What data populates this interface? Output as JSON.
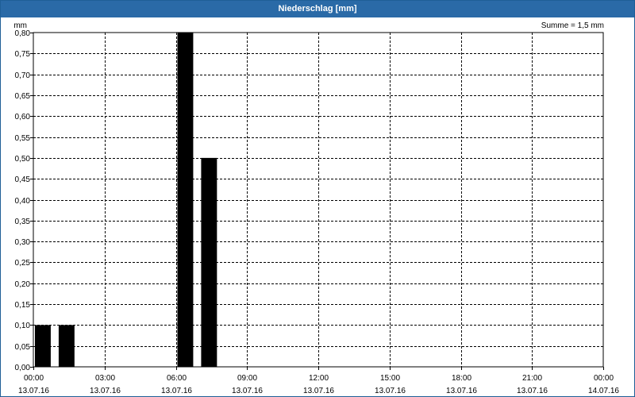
{
  "window": {
    "title": "Niederschlag [mm]"
  },
  "summary": "Summe = 1,5 mm",
  "chart_data": {
    "type": "bar",
    "title": "Niederschlag [mm]",
    "ylabel": "mm",
    "ylim": [
      0,
      0.8
    ],
    "y_ticks": [
      "0,00",
      "0,05",
      "0,10",
      "0,15",
      "0,20",
      "0,25",
      "0,30",
      "0,35",
      "0,40",
      "0,45",
      "0,50",
      "0,55",
      "0,60",
      "0,65",
      "0,70",
      "0,75",
      "0,80"
    ],
    "x_ticks": [
      {
        "time": "00:00",
        "date": "13.07.16"
      },
      {
        "time": "03:00",
        "date": "13.07.16"
      },
      {
        "time": "06:00",
        "date": "13.07.16"
      },
      {
        "time": "09:00",
        "date": "13.07.16"
      },
      {
        "time": "12:00",
        "date": "13.07.16"
      },
      {
        "time": "15:00",
        "date": "13.07.16"
      },
      {
        "time": "18:00",
        "date": "13.07.16"
      },
      {
        "time": "21:00",
        "date": "13.07.16"
      },
      {
        "time": "00:00",
        "date": "14.07.16"
      }
    ],
    "bars": [
      {
        "start": "00:00",
        "end": "01:00",
        "value": 0.1
      },
      {
        "start": "01:00",
        "end": "02:00",
        "value": 0.1
      },
      {
        "start": "06:00",
        "end": "07:00",
        "value": 0.8
      },
      {
        "start": "07:00",
        "end": "08:00",
        "value": 0.5
      }
    ],
    "grid": true,
    "bar_color": "#000000"
  }
}
